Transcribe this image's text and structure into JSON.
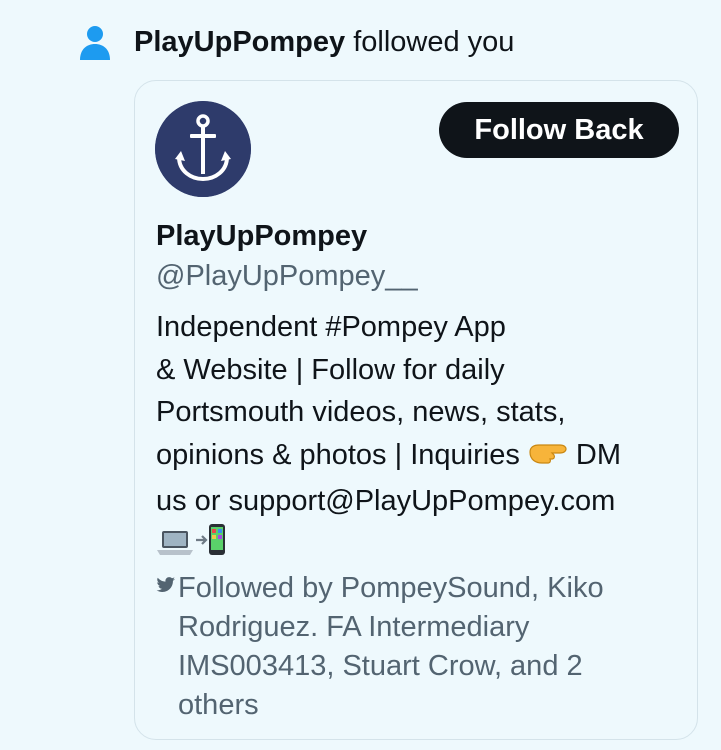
{
  "notification": {
    "icon": "person-icon",
    "actor_name": "PlayUpPompey",
    "action_text": " followed you",
    "accent_color": "#1d9bf0"
  },
  "profile": {
    "avatar": "anchor-icon",
    "avatar_color": "#2e3b6b",
    "follow_button_label": "Follow Back",
    "display_name": "PlayUpPompey",
    "handle": "@PlayUpPompey__",
    "bio_lines": [
      "Independent #Pompey App",
      "& Website | Follow for daily",
      "Portsmouth videos, news, stats,",
      "opinions & photos | Inquiries ",
      "us or support@PlayUpPompey.com",
      ""
    ],
    "bio_after_emoji": " DM",
    "bio_emojis": [
      "backhand-index-pointing-right-icon",
      "laptop-icon",
      "mobile-arrow-icon"
    ],
    "followed_by_icon": "bird-icon",
    "followed_by_lines": [
      "Followed by PompeySound, Kiko",
      "Rodriguez. FA Intermediary",
      "IMS003413, Stuart Crow, and 2",
      "others"
    ]
  }
}
